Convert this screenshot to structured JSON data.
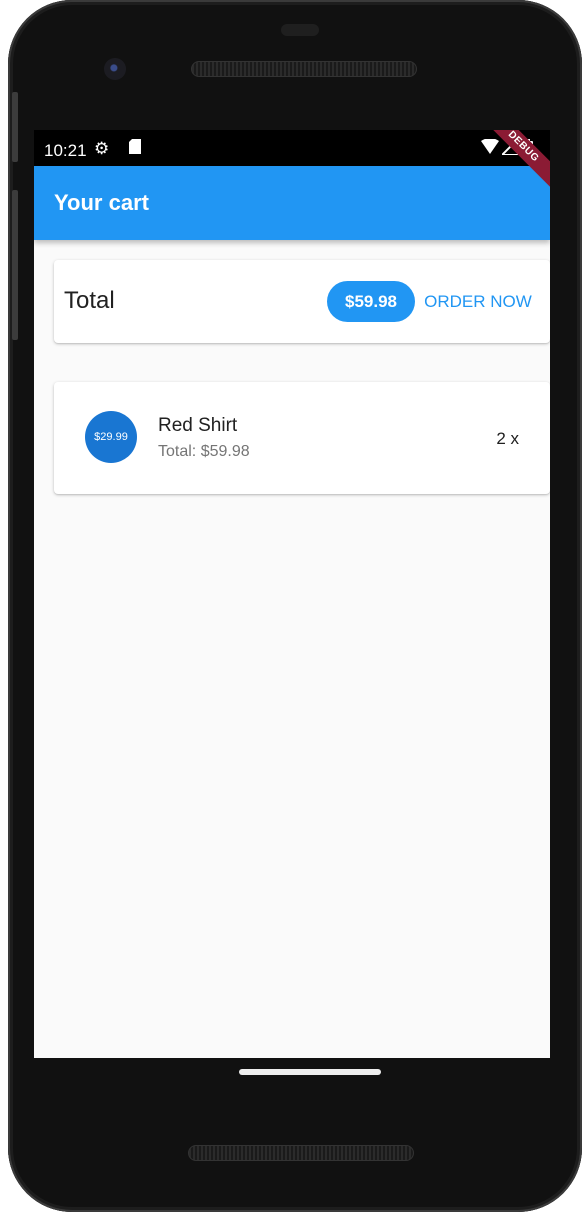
{
  "status_bar": {
    "time": "10:21",
    "icons": [
      "settings-icon",
      "sd-card-icon",
      "wifi-icon",
      "signal-icon",
      "battery-icon"
    ]
  },
  "app_bar": {
    "title": "Your cart",
    "color": "#2196F3"
  },
  "debug_banner": "DEBUG",
  "cart_summary": {
    "label": "Total",
    "amount": "$59.98",
    "order_button": "ORDER NOW"
  },
  "items": [
    {
      "price_badge": "$29.99",
      "title": "Red Shirt",
      "subtitle": "Total: $59.98",
      "quantity": "2 x"
    }
  ]
}
